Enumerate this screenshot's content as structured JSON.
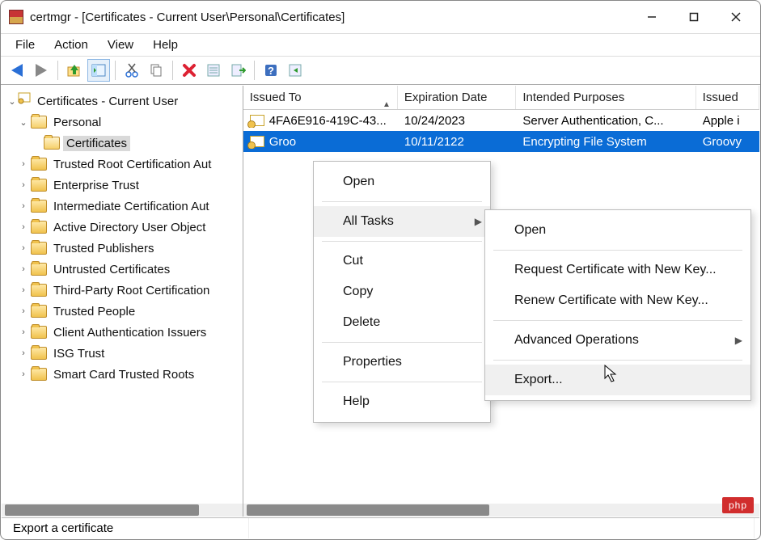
{
  "window": {
    "title": "certmgr - [Certificates - Current User\\Personal\\Certificates]"
  },
  "menu": {
    "file": "File",
    "action": "Action",
    "view": "View",
    "help": "Help"
  },
  "tree": {
    "root": "Certificates - Current User",
    "personal": "Personal",
    "certificates": "Certificates",
    "items": [
      "Trusted Root Certification Aut",
      "Enterprise Trust",
      "Intermediate Certification Aut",
      "Active Directory User Object",
      "Trusted Publishers",
      "Untrusted Certificates",
      "Third-Party Root Certification",
      "Trusted People",
      "Client Authentication Issuers",
      "ISG Trust",
      "Smart Card Trusted Roots"
    ]
  },
  "columns": {
    "c0": "Issued To",
    "c1": "Expiration Date",
    "c2": "Intended Purposes",
    "c3": "Issued"
  },
  "rows": [
    {
      "issued_to": "4FA6E916-419C-43...",
      "exp": "10/24/2023",
      "purpose": "Server Authentication, C...",
      "by": "Apple i"
    },
    {
      "issued_to": "Groo",
      "exp": "10/11/2122",
      "purpose": "Encrypting File System",
      "by": "Groovy"
    }
  ],
  "context_menu": {
    "open": "Open",
    "all_tasks": "All Tasks",
    "cut": "Cut",
    "copy": "Copy",
    "delete": "Delete",
    "properties": "Properties",
    "help": "Help"
  },
  "submenu": {
    "open": "Open",
    "request": "Request Certificate with New Key...",
    "renew": "Renew Certificate with New Key...",
    "advanced": "Advanced Operations",
    "export": "Export..."
  },
  "status": {
    "text": "Export a certificate"
  },
  "badge": "php"
}
